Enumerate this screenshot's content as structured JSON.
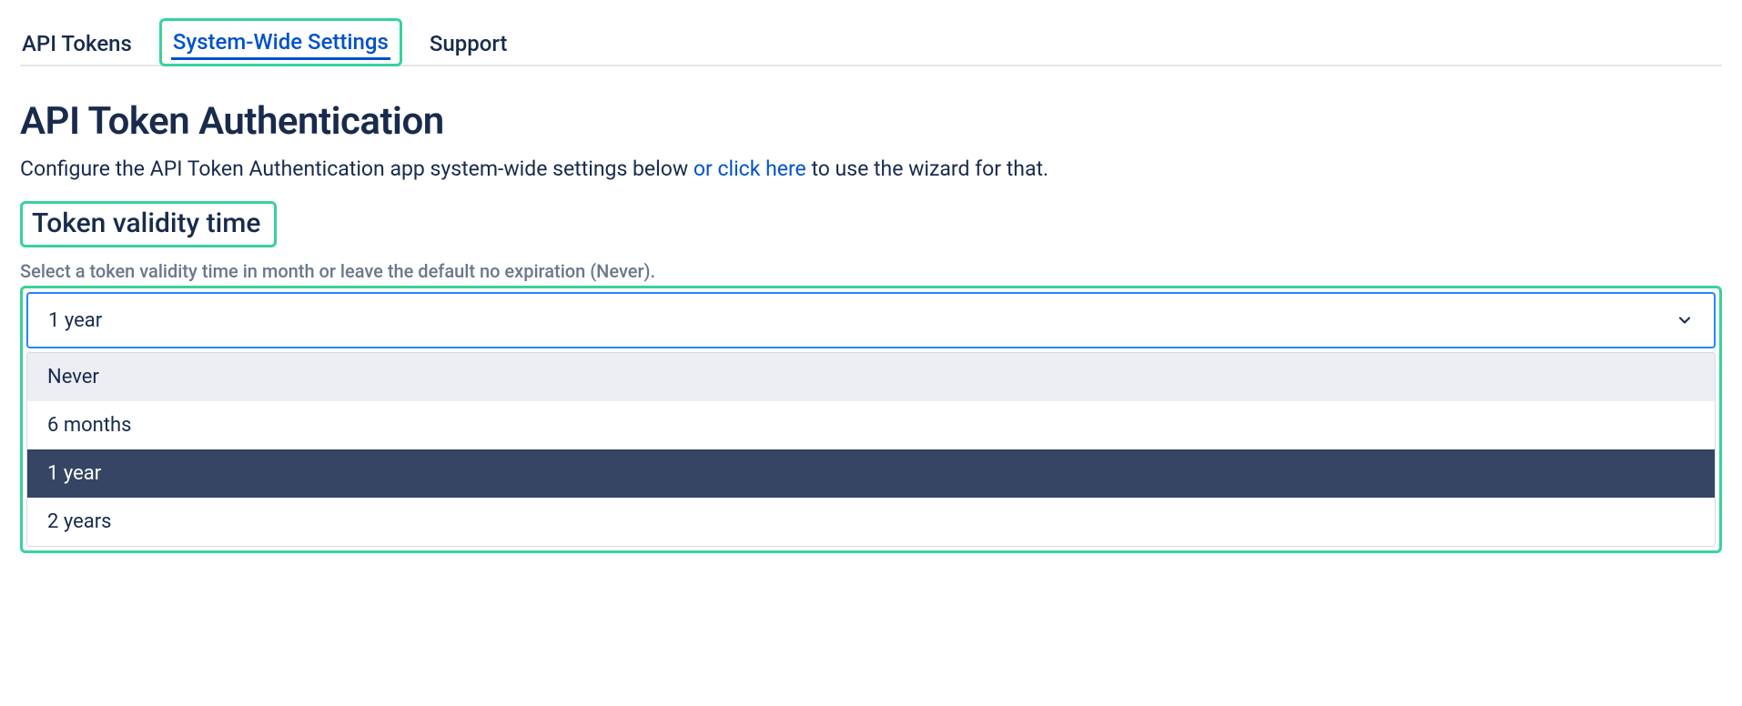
{
  "tabs": {
    "api_tokens": "API Tokens",
    "system_wide": "System-Wide Settings",
    "support": "Support"
  },
  "page": {
    "title": "API Token Authentication",
    "subtitle_prefix": "Configure the API Token Authentication app system-wide settings below ",
    "subtitle_link": "or click here",
    "subtitle_suffix": " to use the wizard for that."
  },
  "section": {
    "heading": "Token validity time",
    "help": "Select a token validity time in month or leave the default no expiration (Never)."
  },
  "select": {
    "value": "1 year",
    "options": {
      "never": "Never",
      "six_months": "6 months",
      "one_year": "1 year",
      "two_years": "2 years"
    }
  }
}
